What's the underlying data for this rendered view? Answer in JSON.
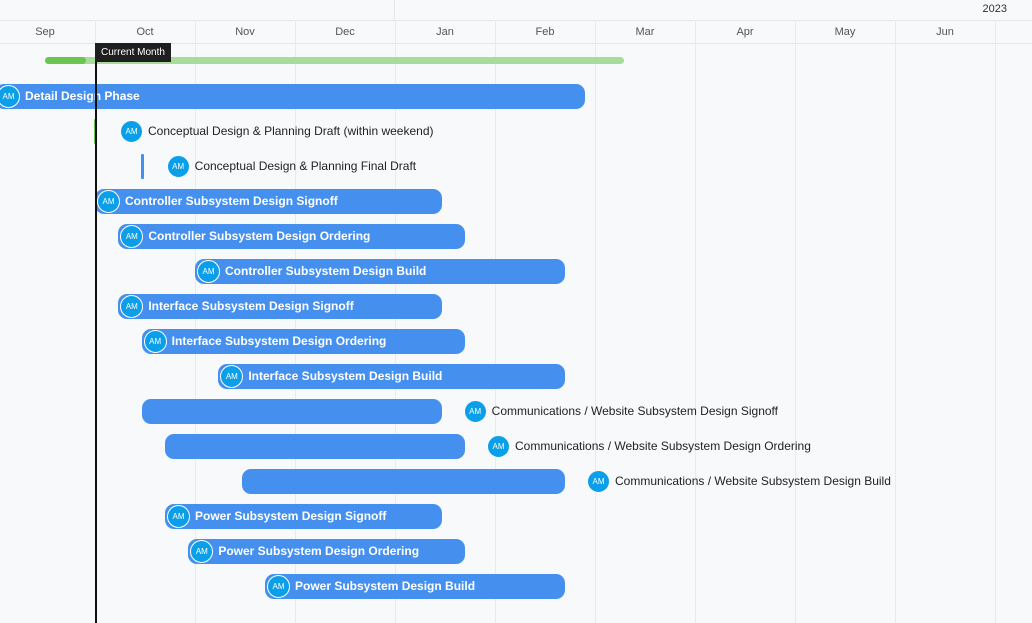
{
  "header": {
    "year": "2023",
    "months": [
      "Sep",
      "Oct",
      "Nov",
      "Dec",
      "Jan",
      "Feb",
      "Mar",
      "Apr",
      "May",
      "Jun"
    ]
  },
  "current_month_label": "Current Month",
  "colors": {
    "bar": "#4590ef",
    "avatar": "#0a9fe8",
    "progress_track": "#a8dc9a",
    "progress_fill": "#6cc550",
    "milestone_green": "#6cc550",
    "milestone_blue": "#4590ef",
    "current_line": "#111111"
  },
  "summary_progress": 0.07,
  "tasks": [
    {
      "name": "Detail Design Phase",
      "assignee": "AM",
      "start": "Sep 1",
      "end": "Feb 28",
      "label_position": "inside"
    },
    {
      "name": "Conceptual Design & Planning Draft (within weekend)",
      "assignee": "AM",
      "date": "Oct 1",
      "type": "milestone",
      "milestone_color": "green"
    },
    {
      "name": "Conceptual Design & Planning Final Draft",
      "assignee": "AM",
      "date": "Oct 15",
      "type": "milestone",
      "milestone_color": "blue"
    },
    {
      "name": "Controller Subsystem Design Signoff",
      "assignee": "AM",
      "start": "Oct 1",
      "end": "Jan 15",
      "label_position": "inside"
    },
    {
      "name": "Controller Subsystem Design Ordering",
      "assignee": "AM",
      "start": "Oct 8",
      "end": "Jan 22",
      "label_position": "inside"
    },
    {
      "name": "Controller Subsystem Design Build",
      "assignee": "AM",
      "start": "Nov 1",
      "end": "Feb 22",
      "label_position": "inside"
    },
    {
      "name": "Interface Subsystem Design Signoff",
      "assignee": "AM",
      "start": "Oct 8",
      "end": "Jan 15",
      "label_position": "inside"
    },
    {
      "name": "Interface Subsystem Design Ordering",
      "assignee": "AM",
      "start": "Oct 15",
      "end": "Jan 22",
      "label_position": "inside"
    },
    {
      "name": "Interface Subsystem Design Build",
      "assignee": "AM",
      "start": "Nov 8",
      "end": "Feb 22",
      "label_position": "inside"
    },
    {
      "name": "Communications / Website Subsystem Design Signoff",
      "assignee": "AM",
      "start": "Oct 15",
      "end": "Jan 15",
      "label_position": "outside"
    },
    {
      "name": "Communications / Website Subsystem Design Ordering",
      "assignee": "AM",
      "start": "Oct 22",
      "end": "Jan 22",
      "label_position": "outside"
    },
    {
      "name": "Communications / Website Subsystem Design Build",
      "assignee": "AM",
      "start": "Nov 15",
      "end": "Feb 22",
      "label_position": "outside"
    },
    {
      "name": "Power Subsystem Design Signoff",
      "assignee": "AM",
      "start": "Oct 22",
      "end": "Jan 15",
      "label_position": "inside"
    },
    {
      "name": "Power Subsystem Design Ordering",
      "assignee": "AM",
      "start": "Oct 29",
      "end": "Jan 22",
      "label_position": "inside"
    },
    {
      "name": "Power Subsystem Design Build",
      "assignee": "AM",
      "start": "Nov 22",
      "end": "Feb 22",
      "label_position": "inside"
    }
  ]
}
